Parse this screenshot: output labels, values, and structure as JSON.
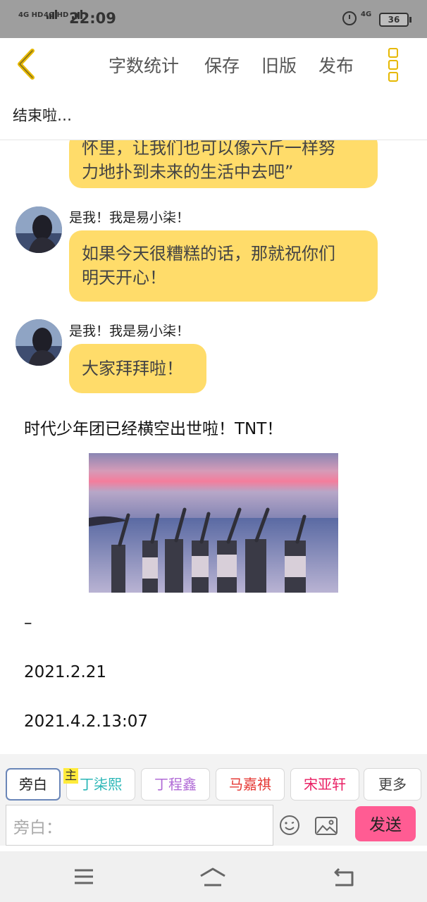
{
  "status_bar": {
    "signal1": "4G HD",
    "signal2": "4G HD",
    "time": "22:09",
    "network": "4G",
    "battery": "36"
  },
  "toolbar": {
    "word_count_label": "字数统计",
    "save_label": "保存",
    "old_version_label": "旧版",
    "publish_label": "发布"
  },
  "chapter_title": "结束啦…",
  "messages": [
    {
      "text_line1": "怀里，让我们也可以像六斤一样努",
      "text_line2": "力地扑到未来的生活中去吧”"
    },
    {
      "speaker": "是我！我是易小柒！",
      "text_line1": "如果今天很糟糕的话，那就祝你们",
      "text_line2": "明天开心！"
    },
    {
      "speaker": "是我！我是易小柒！",
      "text_line1": "大家拜拜啦！"
    }
  ],
  "narration": {
    "line1": "时代少年团已经横空出世啦！TNT！",
    "dash": "–",
    "date1": "2021.2.21",
    "date2": "2021.4.2.13:07"
  },
  "role_bar": {
    "main_badge": "主",
    "roles": [
      {
        "label": "旁白",
        "color": "#555555"
      },
      {
        "label": "丁柒熙",
        "color": "#29b6b6"
      },
      {
        "label": "丁程鑫",
        "color": "#b06ad6"
      },
      {
        "label": "马嘉祺",
        "color": "#e53935"
      },
      {
        "label": "宋亚轩",
        "color": "#e91e63"
      },
      {
        "label": "更多",
        "color": "#444444"
      }
    ],
    "input_placeholder": "旁白：",
    "send_label": "发送"
  },
  "colors": {
    "bubble": "#ffdc6a",
    "accent": "#e6b800",
    "send": "#ff5c93"
  }
}
